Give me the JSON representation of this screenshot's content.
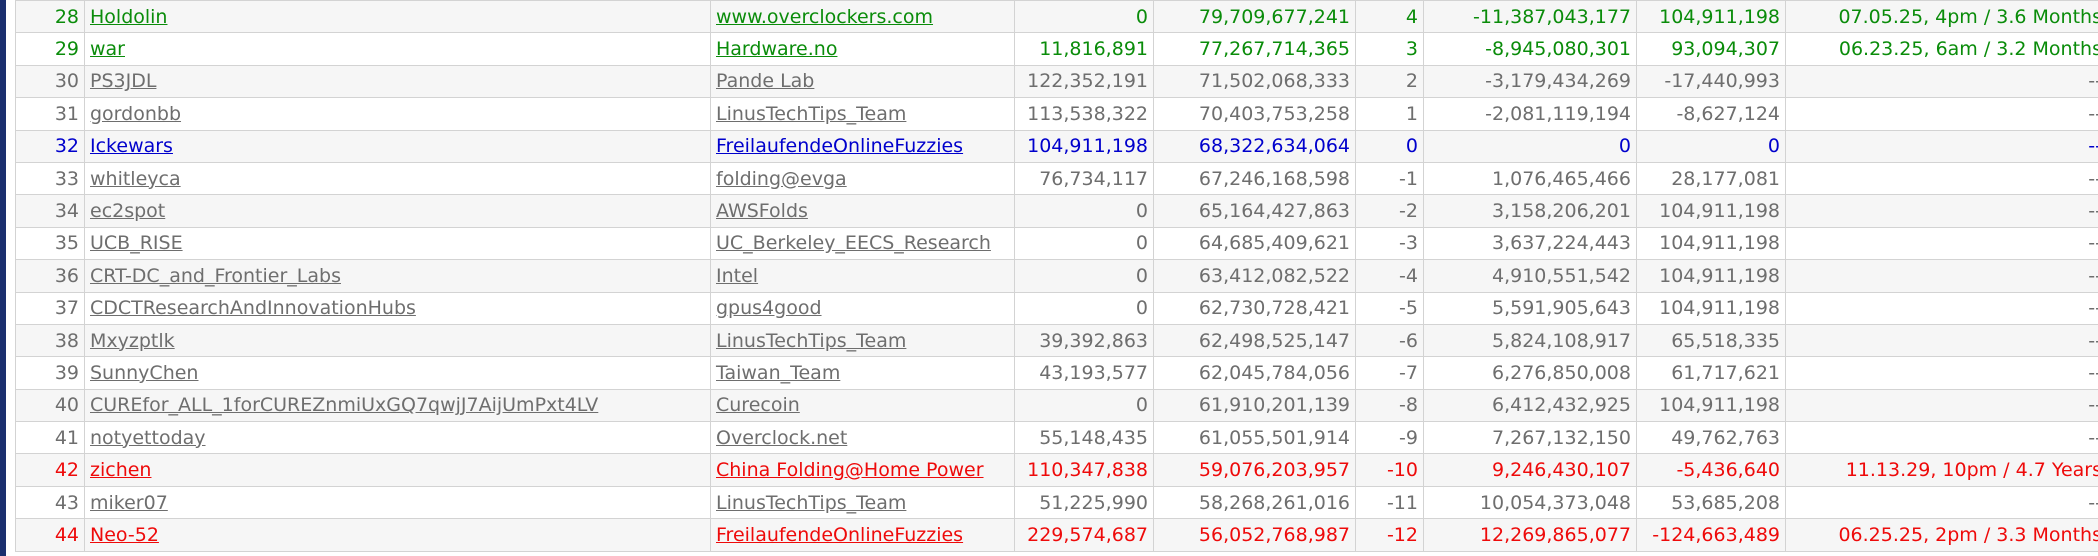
{
  "colors": {
    "border_accent": "#1a2f6e",
    "green": "#0a8c0a",
    "blue": "#0000cc",
    "red": "#ee0a0a",
    "grey": "#6e6e6e",
    "row_alt": "#f6f6f6"
  },
  "rows": [
    {
      "rank": "28",
      "name": "Holdolin",
      "team": "www.overclockers.com",
      "points_24h": "0",
      "score": "79,709,677,241",
      "rank_diff": "4",
      "score_diff": "-11,387,043,177",
      "daily_gain": "104,911,198",
      "eta": "07.05.25, 4pm / 3.6 Months",
      "style": "green"
    },
    {
      "rank": "29",
      "name": "war",
      "team": "Hardware.no",
      "points_24h": "11,816,891",
      "score": "77,267,714,365",
      "rank_diff": "3",
      "score_diff": "-8,945,080,301",
      "daily_gain": "93,094,307",
      "eta": "06.23.25, 6am / 3.2 Months",
      "style": "green"
    },
    {
      "rank": "30",
      "name": "PS3JDL",
      "team": "Pande Lab",
      "points_24h": "122,352,191",
      "score": "71,502,068,333",
      "rank_diff": "2",
      "score_diff": "-3,179,434,269",
      "daily_gain": "-17,440,993",
      "eta": "--",
      "style": "grey"
    },
    {
      "rank": "31",
      "name": "gordonbb",
      "team": "LinusTechTips_Team",
      "points_24h": "113,538,322",
      "score": "70,403,753,258",
      "rank_diff": "1",
      "score_diff": "-2,081,119,194",
      "daily_gain": "-8,627,124",
      "eta": "--",
      "style": "grey"
    },
    {
      "rank": "32",
      "name": "Ickewars",
      "team": "FreilaufendeOnlineFuzzies",
      "points_24h": "104,911,198",
      "score": "68,322,634,064",
      "rank_diff": "0",
      "score_diff": "0",
      "daily_gain": "0",
      "eta": "--",
      "style": "blue"
    },
    {
      "rank": "33",
      "name": "whitleyca",
      "team": "folding@evga",
      "points_24h": "76,734,117",
      "score": "67,246,168,598",
      "rank_diff": "-1",
      "score_diff": "1,076,465,466",
      "daily_gain": "28,177,081",
      "eta": "--",
      "style": "grey"
    },
    {
      "rank": "34",
      "name": "ec2spot",
      "team": "AWSFolds",
      "points_24h": "0",
      "score": "65,164,427,863",
      "rank_diff": "-2",
      "score_diff": "3,158,206,201",
      "daily_gain": "104,911,198",
      "eta": "--",
      "style": "grey"
    },
    {
      "rank": "35",
      "name": "UCB_RISE",
      "team": "UC_Berkeley_EECS_Research",
      "points_24h": "0",
      "score": "64,685,409,621",
      "rank_diff": "-3",
      "score_diff": "3,637,224,443",
      "daily_gain": "104,911,198",
      "eta": "--",
      "style": "grey"
    },
    {
      "rank": "36",
      "name": "CRT-DC_and_Frontier_Labs",
      "team": "Intel",
      "points_24h": "0",
      "score": "63,412,082,522",
      "rank_diff": "-4",
      "score_diff": "4,910,551,542",
      "daily_gain": "104,911,198",
      "eta": "--",
      "style": "grey"
    },
    {
      "rank": "37",
      "name": "CDCTResearchAndInnovationHubs",
      "team": "gpus4good",
      "points_24h": "0",
      "score": "62,730,728,421",
      "rank_diff": "-5",
      "score_diff": "5,591,905,643",
      "daily_gain": "104,911,198",
      "eta": "--",
      "style": "grey"
    },
    {
      "rank": "38",
      "name": "Mxyzptlk",
      "team": "LinusTechTips_Team",
      "points_24h": "39,392,863",
      "score": "62,498,525,147",
      "rank_diff": "-6",
      "score_diff": "5,824,108,917",
      "daily_gain": "65,518,335",
      "eta": "--",
      "style": "grey"
    },
    {
      "rank": "39",
      "name": "SunnyChen",
      "team": "Taiwan_Team",
      "points_24h": "43,193,577",
      "score": "62,045,784,056",
      "rank_diff": "-7",
      "score_diff": "6,276,850,008",
      "daily_gain": "61,717,621",
      "eta": "--",
      "style": "grey"
    },
    {
      "rank": "40",
      "name": "CUREfor_ALL_1forCUREZnmiUxGQ7qwjJ7AijUmPxt4LV",
      "team": "Curecoin",
      "points_24h": "0",
      "score": "61,910,201,139",
      "rank_diff": "-8",
      "score_diff": "6,412,432,925",
      "daily_gain": "104,911,198",
      "eta": "--",
      "style": "grey"
    },
    {
      "rank": "41",
      "name": "notyettoday",
      "team": "Overclock.net",
      "points_24h": "55,148,435",
      "score": "61,055,501,914",
      "rank_diff": "-9",
      "score_diff": "7,267,132,150",
      "daily_gain": "49,762,763",
      "eta": "--",
      "style": "grey"
    },
    {
      "rank": "42",
      "name": "zichen",
      "team": "China Folding@Home Power",
      "points_24h": "110,347,838",
      "score": "59,076,203,957",
      "rank_diff": "-10",
      "score_diff": "9,246,430,107",
      "daily_gain": "-5,436,640",
      "eta": "11.13.29, 10pm / 4.7 Years",
      "style": "red"
    },
    {
      "rank": "43",
      "name": "miker07",
      "team": "LinusTechTips_Team",
      "points_24h": "51,225,990",
      "score": "58,268,261,016",
      "rank_diff": "-11",
      "score_diff": "10,054,373,048",
      "daily_gain": "53,685,208",
      "eta": "--",
      "style": "grey"
    },
    {
      "rank": "44",
      "name": "Neo-52",
      "team": "FreilaufendeOnlineFuzzies",
      "points_24h": "229,574,687",
      "score": "56,052,768,987",
      "rank_diff": "-12",
      "score_diff": "12,269,865,077",
      "daily_gain": "-124,663,489",
      "eta": "06.25.25, 2pm / 3.3 Months",
      "style": "red"
    }
  ]
}
